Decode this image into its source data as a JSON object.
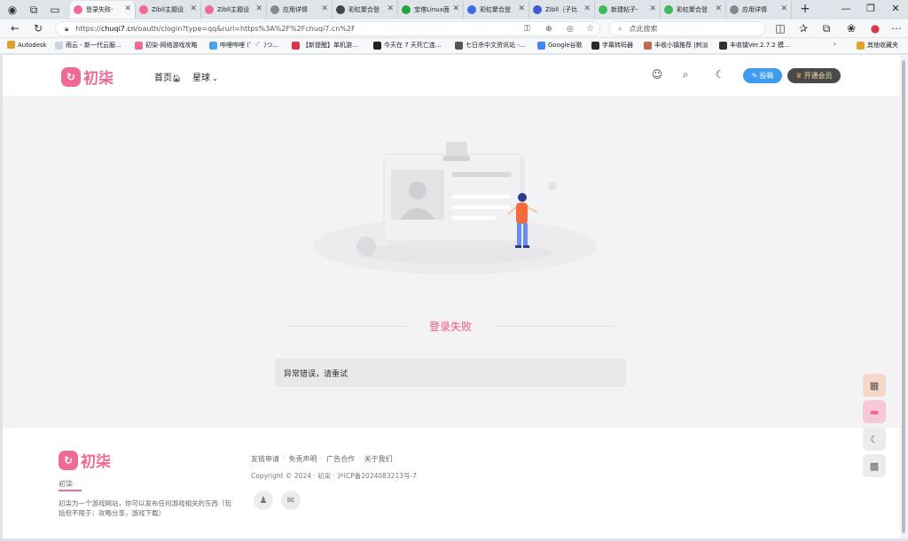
{
  "browser": {
    "tabs": [
      {
        "title": "登录失败-",
        "color": "#f06a96",
        "active": true
      },
      {
        "title": "Zibll主题设",
        "color": "#f06a96"
      },
      {
        "title": "Zibll主题设",
        "color": "#f06a96"
      },
      {
        "title": "应用详情",
        "color": "#888888"
      },
      {
        "title": "彩虹聚合登",
        "color": "#444444"
      },
      {
        "title": "宝塔Linux面",
        "color": "#20a53a"
      },
      {
        "title": "彩虹聚合登",
        "color": "#3d6ee0"
      },
      {
        "title": "Zibll（子比",
        "color": "#3d5bd9"
      },
      {
        "title": "新建帖子-",
        "color": "#3dbb5c"
      },
      {
        "title": "彩虹聚合登",
        "color": "#3dbb5c"
      },
      {
        "title": "应用详情",
        "color": "#888888"
      }
    ],
    "new_tab": "+",
    "url_prefix": "https://",
    "url_host": "chuqi7.cn",
    "url_path": "/oauth/clogin?type=qq&rurl=https%3A%2F%2Fchuqi7.cn%2F",
    "search_placeholder": "点此搜索",
    "bookmarks": [
      {
        "label": "Autodesk",
        "color": "#e0a12a"
      },
      {
        "label": "雨云 - 新一代云服...",
        "color": "#cfd6e0"
      },
      {
        "label": "初柒-网络游戏攻略",
        "color": "#f06a96"
      },
      {
        "label": "哔哩哔哩 (゜-゜)つ...",
        "color": "#4aa6e8"
      },
      {
        "label": "【新提醒】单机游...",
        "color": "#d9364a"
      },
      {
        "label": "今天在 7 天死亡连...",
        "color": "#222222"
      },
      {
        "label": "七日杀中文资讯站 -...",
        "color": "#555555"
      },
      {
        "label": "Google谷歌",
        "color": "#4285f4"
      },
      {
        "label": "字幕转码器",
        "color": "#2a2a2a"
      },
      {
        "label": "丰收小镇推荐 |刺淡",
        "color": "#c06a4a"
      },
      {
        "label": "丰收镇Ver.2.7.2 模...",
        "color": "#333333"
      },
      {
        "label": "其他收藏夹",
        "color": "#e0a12a"
      }
    ]
  },
  "site": {
    "logo_text": "初柒",
    "nav": {
      "home": "首页",
      "planet": "星球"
    },
    "post_button": "投稿",
    "vip_button": "开通会员"
  },
  "error": {
    "title": "登录失败",
    "message": "异常错误，请重试"
  },
  "footer": {
    "logo_text": "初柒",
    "site_name": "初柒",
    "description": "初柒为一个游戏网站，你可以发布任何游戏相关的东西（包括但不限于：攻略分享，游戏下载）",
    "links": [
      "友链申请",
      "免责声明",
      "广告合作",
      "关于我们"
    ],
    "copyright": "Copyright © 2024 · 初柒 · 沪ICP备2024083213号-7"
  },
  "colors": {
    "brand": "#f06a96",
    "post_button": "#3d9bf2",
    "vip_button": "#4a4a4a",
    "error_title": "#f0577c"
  }
}
